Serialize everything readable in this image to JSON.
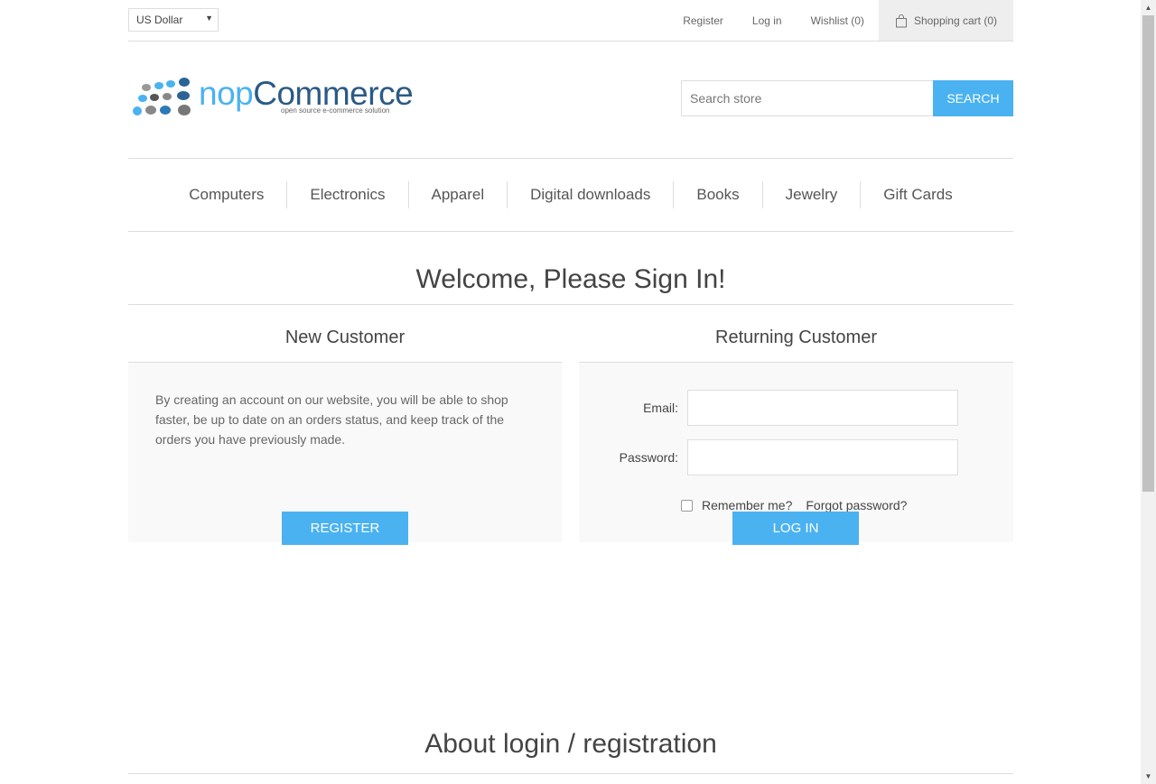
{
  "header": {
    "currency": "US Dollar",
    "links": {
      "register": "Register",
      "login": "Log in",
      "wishlist": "Wishlist (0)",
      "cart": "Shopping cart (0)"
    }
  },
  "logo": {
    "name_prefix": "nop",
    "name_suffix": "Commerce",
    "tagline": "open source e-commerce solution"
  },
  "search": {
    "placeholder": "Search store",
    "button": "SEARCH"
  },
  "nav": {
    "items": [
      "Computers",
      "Electronics",
      "Apparel",
      "Digital downloads",
      "Books",
      "Jewelry",
      "Gift Cards"
    ]
  },
  "page": {
    "title": "Welcome, Please Sign In!",
    "about_title": "About login / registration"
  },
  "new_customer": {
    "title": "New Customer",
    "text": "By creating an account on our website, you will be able to shop faster, be up to date on an orders status, and keep track of the orders you have previously made.",
    "button": "REGISTER"
  },
  "returning_customer": {
    "title": "Returning Customer",
    "email_label": "Email:",
    "password_label": "Password:",
    "remember_label": "Remember me?",
    "forgot_label": "Forgot password?",
    "button": "LOG IN"
  },
  "colors": {
    "accent": "#4ab2f1",
    "border": "#dddddd",
    "panel": "#f9f9f9"
  }
}
